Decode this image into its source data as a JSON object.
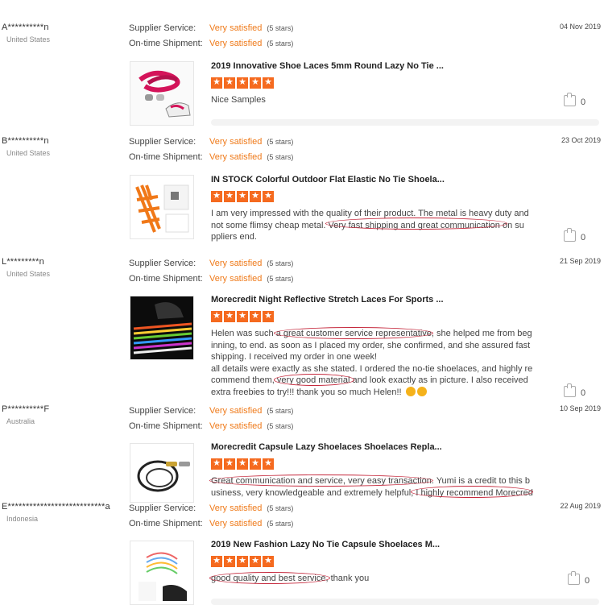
{
  "labels": {
    "supplier": "Supplier Service:",
    "shipment": "On-time Shipment:"
  },
  "reviews": [
    {
      "user": "A**********n",
      "country": "United States",
      "date": "04 Nov 2019",
      "supplier_value": "Very satisfied",
      "supplier_stars": "(5 stars)",
      "shipment_value": "Very satisfied",
      "shipment_stars": "(5 stars)",
      "product": "2019 Innovative Shoe Laces 5mm Round Lazy No Tie ...",
      "rating": 5,
      "lines": [
        "Nice Samples"
      ],
      "likes": "0"
    },
    {
      "user": "B**********n",
      "country": "United States",
      "date": "23 Oct 2019",
      "supplier_value": "Very satisfied",
      "supplier_stars": "(5 stars)",
      "shipment_value": "Very satisfied",
      "shipment_stars": "(5 stars)",
      "product": "IN STOCK Colorful Outdoor Flat Elastic No Tie Shoela...",
      "rating": 5,
      "lines": [
        "I am very impressed with the quality of their product. The metal is heavy duty and",
        "not some flimsy cheap metal. Very fast shipping and great communication on su",
        "ppliers end."
      ],
      "likes": "0"
    },
    {
      "user": "L*********n",
      "country": "United States",
      "date": "21 Sep 2019",
      "supplier_value": "Very satisfied",
      "supplier_stars": "(5 stars)",
      "shipment_value": "Very satisfied",
      "shipment_stars": "(5 stars)",
      "product": "Morecredit Night Reflective Stretch Laces For Sports ...",
      "rating": 5,
      "lines": [
        "Helen was such a great customer service representative, she helped me from beg",
        "inning, to end. as soon as I placed my order, she confirmed, and she assured fast",
        "shipping. I received my order in one week!",
        "all details were exactly as she stated. I ordered the no-tie shoelaces, and highly re",
        "commend them, very good material and look exactly as in picture. I also received",
        "extra freebies to try!!! thank you so much Helen!!"
      ],
      "likes": "0"
    },
    {
      "user": "P**********F",
      "country": "Australia",
      "date": "10 Sep 2019",
      "supplier_value": "Very satisfied",
      "supplier_stars": "(5 stars)",
      "shipment_value": "Very satisfied",
      "shipment_stars": "(5 stars)",
      "product": "Morecredit Capsule Lazy Shoelaces Shoelaces Repla...",
      "rating": 5,
      "lines": [
        "Great communication and service, very easy transaction. Yumi is a credit to this b",
        "usiness, very knowledgeable and extremely helpful, I highly recommend Morecred"
      ],
      "likes": "0"
    },
    {
      "user": "E***************************a",
      "country": "Indonesia",
      "date": "22 Aug 2019",
      "supplier_value": "Very satisfied",
      "supplier_stars": "(5 stars)",
      "shipment_value": "Very satisfied",
      "shipment_stars": "(5 stars)",
      "product": "2019 New Fashion Lazy No Tie Capsule Shoelaces M...",
      "rating": 5,
      "lines": [
        "good quality and best service, thank you"
      ],
      "likes": "0"
    }
  ],
  "colors": {
    "accent": "#ef7a1a",
    "star": "#f56a1f",
    "highlight": "#c5283c"
  }
}
